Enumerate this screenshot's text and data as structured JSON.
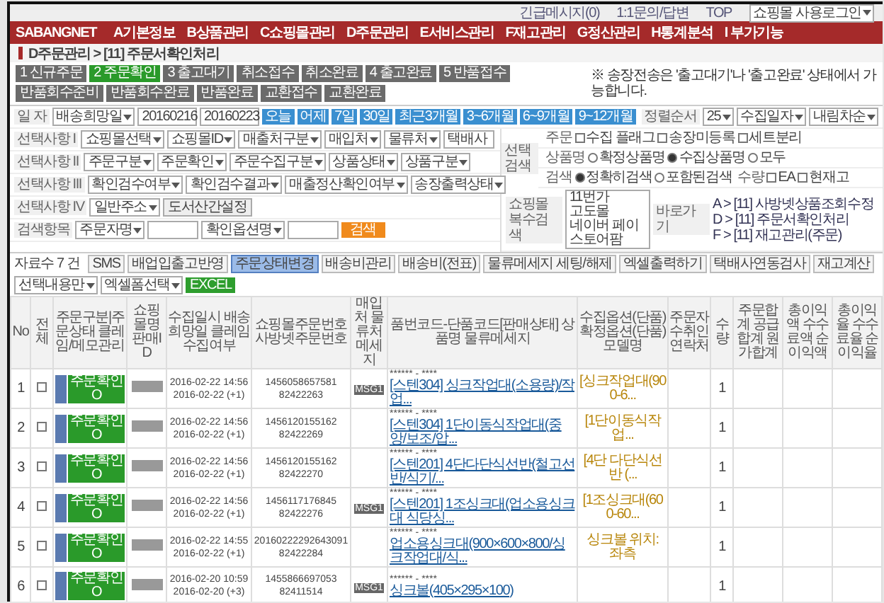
{
  "top_links": [
    "긴급메시지(0)",
    "1:1문의/답변",
    "TOP"
  ],
  "user_select": "쇼핑몰 사용로그인",
  "logo": "SABANGNET",
  "nav": [
    "A기본정보",
    "B상품관리",
    "C쇼핑몰관리",
    "D주문관리",
    "E서비스관리",
    "F재고관리",
    "G정산관리",
    "H통계분석",
    "I 부가기능"
  ],
  "breadcrumb": "D주문관리 > [11] 주문서확인처리",
  "steps": [
    {
      "label": "1 신규주문",
      "selected": false
    },
    {
      "label": "2 주문확인",
      "selected": true
    },
    {
      "label": "3 출고대기",
      "selected": false
    },
    {
      "label": "취소접수",
      "selected": false
    },
    {
      "label": "취소완료",
      "selected": false
    },
    {
      "label": "4 출고완료",
      "selected": false
    },
    {
      "label": "5 반품접수",
      "selected": false
    },
    {
      "label": "반품회수준비",
      "selected": false
    },
    {
      "label": "반품회수완료",
      "selected": false
    },
    {
      "label": "반품완료",
      "selected": false
    },
    {
      "label": "교환접수",
      "selected": false
    },
    {
      "label": "교환완료",
      "selected": false
    }
  ],
  "step_note": "※ 송장전송은 '출고대기'나 '출고완료' 상태에서 가능합니다.",
  "date_row": {
    "label": "일 자",
    "type": "배송희망일",
    "from": "20160216",
    "to": "20160223",
    "quick": [
      "오늘",
      "어제",
      "7일",
      "30일",
      "최근3개월",
      "3~6개월",
      "6~9개월",
      "9~12개월"
    ],
    "sort_label": "정렬순서",
    "page_size": "25",
    "sort_by": "수집일자",
    "order": "내림차순"
  },
  "filters": [
    {
      "label": "선택사항 I",
      "selects": [
        "쇼핑몰선택",
        "쇼핑몰ID",
        "매출처구분",
        "매입처",
        "물류처"
      ],
      "value": "택배사"
    },
    {
      "label": "선택사항 II",
      "selects": [
        "주문구분",
        "주문확인",
        "주문수집구분",
        "상품상태",
        "상품구분"
      ]
    },
    {
      "label": "선택사항 III",
      "selects": [
        "확인검수여부",
        "확인검수결과",
        "매출정산확인여부",
        "송장출력상태"
      ]
    },
    {
      "label": "선택사항 IV",
      "selects": [
        "일반주소"
      ],
      "button": "도서산간설정"
    },
    {
      "label": "검색항목",
      "selects": [
        "주문자명",
        "확인옵션명"
      ],
      "search": "검색"
    }
  ],
  "select_search": {
    "label": "선택검색",
    "order_label": "주문",
    "order_checks": [
      {
        "label": "수집 플래그",
        "checked": false
      },
      {
        "label": "송장미등록",
        "checked": false
      },
      {
        "label": "세트분리",
        "checked": false
      }
    ],
    "name_label": "상품명",
    "name_radios": [
      {
        "label": "확정상품명",
        "selected": false
      },
      {
        "label": "수집상품명",
        "selected": true
      },
      {
        "label": "모두",
        "selected": false
      }
    ],
    "mode_label": "검색",
    "mode_radios": [
      {
        "label": "정확히검색",
        "selected": true
      },
      {
        "label": "포함된검색",
        "selected": false
      }
    ],
    "qty_label": "수량",
    "qty_checks": [
      {
        "label": "EA",
        "checked": false
      },
      {
        "label": "현재고",
        "checked": false
      }
    ]
  },
  "multi_mall": {
    "label": "쇼핑몰복수검색",
    "options": [
      "11번가",
      "고도몰",
      "네이버 페이",
      "스토어팜"
    ]
  },
  "shortcuts": {
    "label": "바로가기",
    "links": [
      "A > [11] 사방넷상품조회수정",
      "D > [11] 주문서확인처리",
      "F > [11] 재고관리(주문)"
    ]
  },
  "count": "자료수 7 건",
  "toolbar": [
    {
      "label": "SMS",
      "selected": false
    },
    {
      "label": "배업입출고반영",
      "selected": false
    },
    {
      "label": "주문상태변경",
      "selected": true
    },
    {
      "label": "배송비관리",
      "selected": false
    },
    {
      "label": "배송비(전표)",
      "selected": false
    },
    {
      "label": "물류메세지 세팅/해제",
      "selected": false
    },
    {
      "label": "엑셀출력하기",
      "selected": false
    },
    {
      "label": "택배사연동검사",
      "selected": false
    },
    {
      "label": "재고계산",
      "selected": false
    }
  ],
  "export": {
    "scope": "선택내용만",
    "form": "엑셀폼선택",
    "button": "EXCEL"
  },
  "columns": [
    "No",
    "전체",
    "주문구분|주문상태 클레임/메모관리",
    "쇼핑몰명 판매ID",
    "수집일시 배송희망일 클레임수집여부",
    "쇼핑몰주문번호 사방넷주문번호",
    "매입처 물류처 메세지",
    "품번코드-단품코드[판매상태] 상품명 물류메세지",
    "수집옵션(단품) 확정옵션(단품) 모델명",
    "주문자 수취인 연락처",
    "수량",
    "주문합계 공급합계 원가합계",
    "총이익액 수수료액 순이익액",
    "총이익율 수수료율 순이익율"
  ],
  "rows": [
    {
      "no": "1",
      "checked": false,
      "status": "주문확인 O",
      "date": "2016-02-22 14:56",
      "wish": "2016-02-22 (+1)",
      "order_no": "1456058657581",
      "sabang_no": "82422263",
      "msg": "MSG1",
      "masked": "****** - ****",
      "product": "[스텐304] 싱크작업대(소용량)/작업...",
      "option": "[싱크작업대(900-6...",
      "qty": "1"
    },
    {
      "no": "2",
      "checked": false,
      "status": "주문확인 O",
      "date": "2016-02-22 14:56",
      "wish": "2016-02-22 (+1)",
      "order_no": "1456120155162",
      "sabang_no": "82422269",
      "masked": "****** - ****",
      "product": "[스텐304] 1단이동식작업대(중앙/보조/압...",
      "option": "[1단이동식작업...",
      "qty": "1"
    },
    {
      "no": "3",
      "checked": false,
      "status": "주문확인 O",
      "date": "2016-02-22 14:56",
      "wish": "2016-02-22 (+1)",
      "order_no": "1456120155162",
      "sabang_no": "82422270",
      "masked": "****** - ****",
      "product": "[스텐201] 4단다단식선반(철고선반/식기/...",
      "option": "[4단 다단식선반 (...",
      "qty": "1"
    },
    {
      "no": "4",
      "checked": false,
      "status": "주문확인 O",
      "date": "2016-02-22 14:56",
      "wish": "2016-02-22 (+1)",
      "order_no": "1456117176845",
      "sabang_no": "82422276",
      "msg": "MSG1",
      "masked": "****** - ****",
      "product": "[스텐201] 1조싱크대(업소용싱크대 식당싱...",
      "option": "[1조싱크대(600-60...",
      "qty": "1"
    },
    {
      "no": "5",
      "checked": false,
      "status": "주문확인 O",
      "date": "2016-02-22 14:55",
      "wish": "2016-02-22 (+1)",
      "order_no": "20160222292643091",
      "sabang_no": "82422284",
      "masked": "****** - ****",
      "product": "업소용싱크대(900×600×800/싱크작업대/식...",
      "option": "싱크볼 위치: 좌측",
      "qty": "1"
    },
    {
      "no": "6",
      "checked": false,
      "status": "주문확인 O",
      "date": "2016-02-20 10:59",
      "wish": "2016-02-20 (+3)",
      "order_no": "1455866697053",
      "sabang_no": "82411514",
      "msg": "MSG1",
      "masked": "****** - ****",
      "product": "싱크볼(405×295×100)",
      "option": "",
      "qty": "1"
    }
  ]
}
